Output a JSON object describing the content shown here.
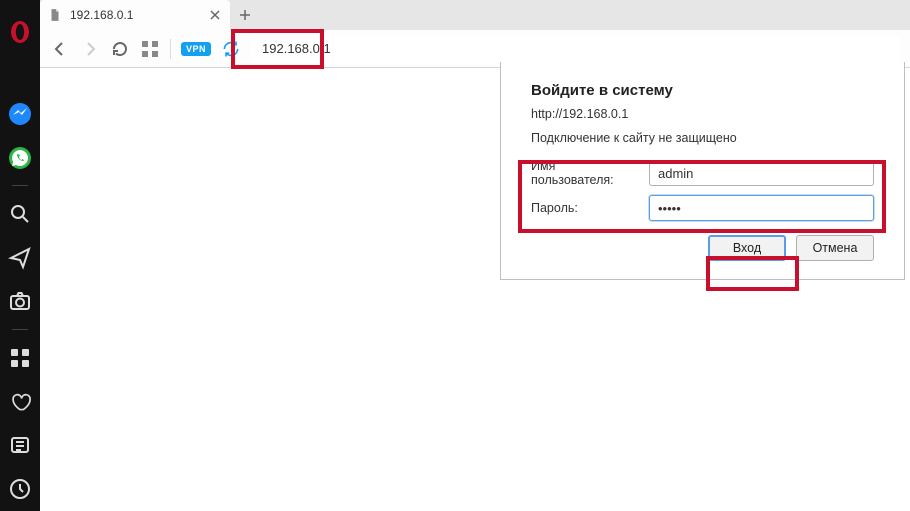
{
  "sidebar": {
    "items": [
      {
        "name": "opera-logo"
      },
      {
        "name": "messenger-icon"
      },
      {
        "name": "whatsapp-icon"
      },
      {
        "name": "search-icon"
      },
      {
        "name": "send-icon"
      },
      {
        "name": "camera-icon"
      },
      {
        "name": "speed-dial-icon"
      },
      {
        "name": "heart-icon"
      },
      {
        "name": "news-icon"
      },
      {
        "name": "history-icon"
      }
    ]
  },
  "tab": {
    "title": "192.168.0.1"
  },
  "toolbar": {
    "vpn_label": "VPN",
    "address": "192.168.0.1"
  },
  "auth": {
    "title": "Войдите в систему",
    "url": "http://192.168.0.1",
    "warning": "Подключение к сайту не защищено",
    "username_label": "Имя пользователя:",
    "password_label": "Пароль:",
    "username_value": "admin",
    "password_value": "•••••",
    "login_label": "Вход",
    "cancel_label": "Отмена"
  },
  "highlights": {
    "color": "#c8102e"
  }
}
